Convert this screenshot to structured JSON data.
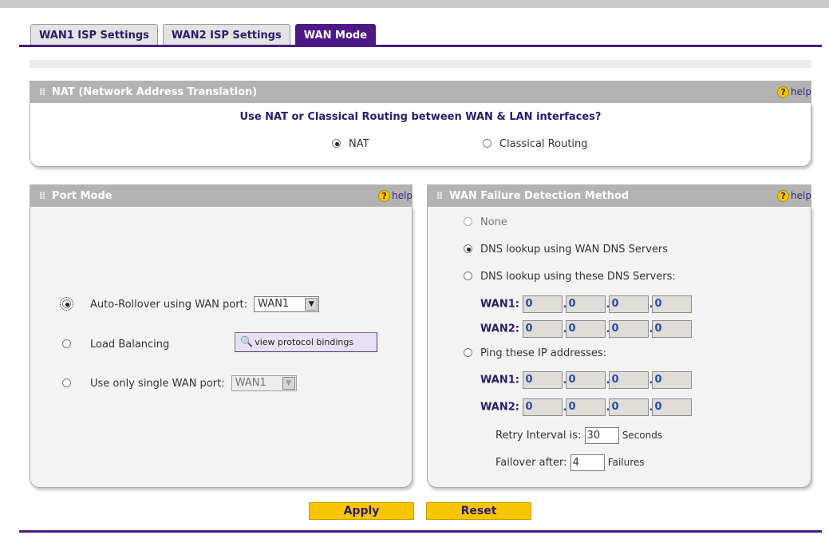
{
  "tabs": [
    {
      "label": "WAN1 ISP Settings",
      "active": false
    },
    {
      "label": "WAN2 ISP Settings",
      "active": false
    },
    {
      "label": "WAN Mode",
      "active": true
    }
  ],
  "help_label": "help",
  "nat": {
    "title": "NAT (Network Address Translation)",
    "question": "Use NAT or Classical Routing between WAN & LAN interfaces?",
    "options": [
      "NAT",
      "Classical Routing"
    ],
    "selected": "NAT"
  },
  "port_mode": {
    "title": "Port Mode",
    "auto_rollover_label": "Auto-Rollover using WAN port:",
    "auto_rollover_port": "WAN1",
    "load_balancing_label": "Load Balancing",
    "view_bindings_label": "view protocol bindings",
    "single_port_label": "Use only single WAN port:",
    "single_port_value": "WAN1",
    "selected": "Auto-Rollover"
  },
  "failure_detection": {
    "title": "WAN Failure Detection Method",
    "option_none": "None",
    "option_dns_wan": "DNS lookup using WAN DNS Servers",
    "option_dns_custom": "DNS lookup using these DNS Servers:",
    "option_ping": "Ping these IP addresses:",
    "selected": "DNS lookup using WAN DNS Servers",
    "wan1_label": "WAN1:",
    "wan2_label": "WAN2:",
    "dns_wan1": [
      "0",
      "0",
      "0",
      "0"
    ],
    "dns_wan2": [
      "0",
      "0",
      "0",
      "0"
    ],
    "ping_wan1": [
      "0",
      "0",
      "0",
      "0"
    ],
    "ping_wan2": [
      "0",
      "0",
      "0",
      "0"
    ],
    "retry_label": "Retry Interval is:",
    "retry_value": "30",
    "retry_unit": "Seconds",
    "failover_label": "Failover after:",
    "failover_value": "4",
    "failover_unit": "Failures"
  },
  "actions": {
    "apply": "Apply",
    "reset": "Reset"
  },
  "colors": {
    "brand_purple": "#4b1a86",
    "button_yellow": "#f7c600",
    "header_gray": "#b3b3b3"
  }
}
